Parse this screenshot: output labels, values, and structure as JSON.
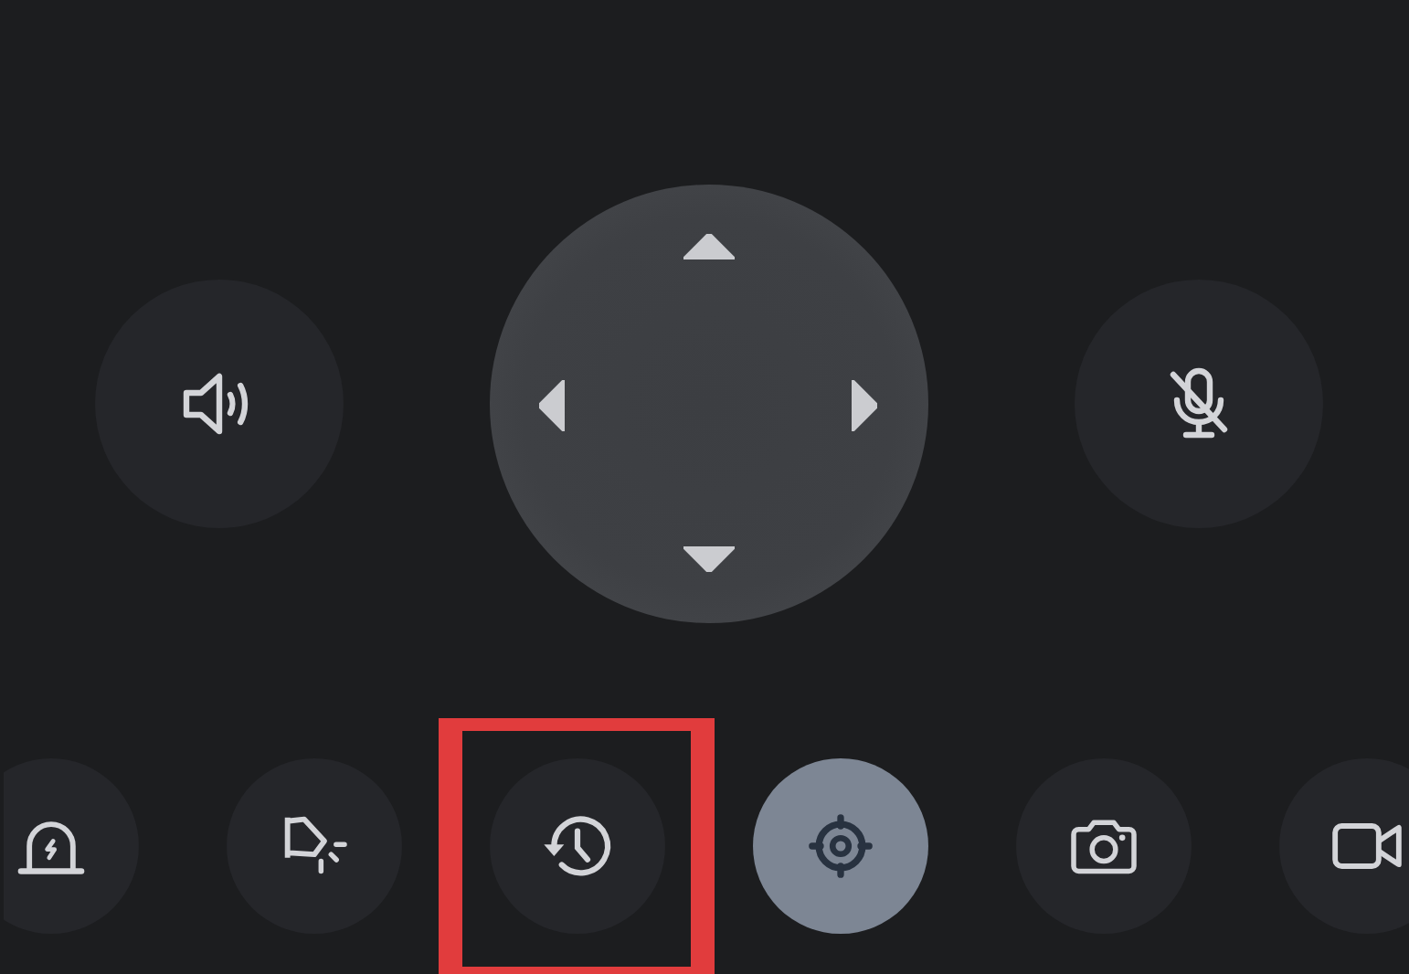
{
  "top_controls": [
    {
      "kind": "speaker"
    },
    {
      "kind": "dpad"
    },
    {
      "kind": "microphone",
      "muted": true
    }
  ],
  "bottom_controls": [
    {
      "kind": "siren",
      "selected": false,
      "highlighted": false
    },
    {
      "kind": "lamp",
      "selected": false,
      "highlighted": false
    },
    {
      "kind": "history",
      "selected": false,
      "highlighted": true
    },
    {
      "kind": "target",
      "selected": true,
      "highlighted": false
    },
    {
      "kind": "camera",
      "selected": false,
      "highlighted": false
    },
    {
      "kind": "video",
      "selected": false,
      "highlighted": false
    }
  ]
}
